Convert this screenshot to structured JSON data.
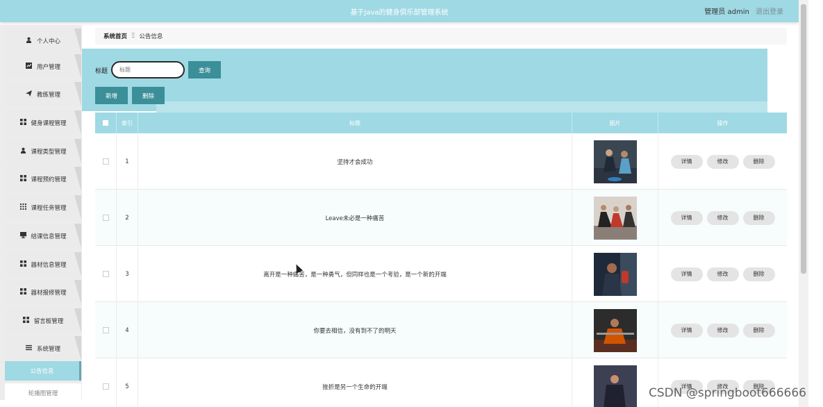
{
  "header": {
    "title": "基于Java的健身俱乐部管理系统",
    "user_label": "管理员 admin",
    "logout": "退出登录"
  },
  "sidebar": {
    "items": [
      {
        "label": "个人中心",
        "icon": "user-icon"
      },
      {
        "label": "用户管理",
        "icon": "chart-icon"
      },
      {
        "label": "教练管理",
        "icon": "send-icon"
      },
      {
        "label": "健身课程管理",
        "icon": "grid-icon"
      },
      {
        "label": "课程类型管理",
        "icon": "person-icon"
      },
      {
        "label": "课程预约管理",
        "icon": "grid-icon"
      },
      {
        "label": "课程任务管理",
        "icon": "apps-icon"
      },
      {
        "label": "结课信息管理",
        "icon": "monitor-icon"
      },
      {
        "label": "器材信息管理",
        "icon": "grid-icon"
      },
      {
        "label": "器材报修管理",
        "icon": "grid-icon"
      },
      {
        "label": "留言板管理",
        "icon": "grid-icon"
      },
      {
        "label": "系统管理",
        "icon": "menu-icon"
      }
    ],
    "sub_items": [
      {
        "label": "公告信息",
        "active": true
      },
      {
        "label": "轮播图管理",
        "active": false
      }
    ]
  },
  "breadcrumb": {
    "home": "系统首页",
    "separator": "Ξ",
    "current": "公告信息"
  },
  "search": {
    "label": "标题",
    "placeholder": "标题",
    "query_button": "查询"
  },
  "actions": {
    "add": "新增",
    "delete": "删除"
  },
  "table": {
    "headers": {
      "index": "索引",
      "title": "标题",
      "image": "图片",
      "ops": "操作"
    },
    "rows": [
      {
        "index": "1",
        "title": "坚持才会成功"
      },
      {
        "index": "2",
        "title": "Leave未必是一种痛苦"
      },
      {
        "index": "3",
        "title": "离开是一种痛苦，是一种勇气，但同样也是一个考验，是一个新的开端"
      },
      {
        "index": "4",
        "title": "你要去相信，没有到不了的明天"
      },
      {
        "index": "5",
        "title": "挫折是另一个生命的开端"
      }
    ],
    "row_buttons": {
      "detail": "详情",
      "edit": "修改",
      "delete": "删除"
    }
  },
  "watermark": "CSDN @springboot666666",
  "colors": {
    "accent": "#9fd9e3",
    "button": "#3a8f98"
  }
}
